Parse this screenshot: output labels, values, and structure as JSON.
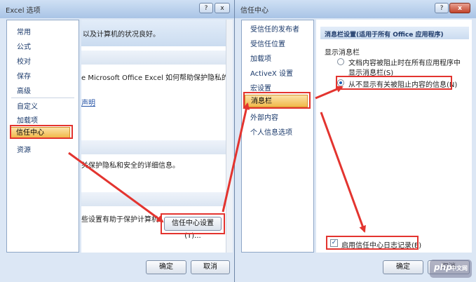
{
  "left_dialog": {
    "title": "Excel 选项",
    "help_glyph": "?",
    "close_glyph": "x",
    "nav_items": [
      "常用",
      "公式",
      "校对",
      "保存",
      "高级",
      "自定义",
      "加载项",
      "信任中心",
      "资源"
    ],
    "selected_nav": "信任中心",
    "content": {
      "line1": "以及计算机的状况良好。",
      "line2": "e Microsoft Office Excel 如何帮助保护隐私的详",
      "link1": "声明",
      "line3": "关保护隐私和安全的详细信息。",
      "line4": "些设置有助于保护计算机",
      "trust_center_settings_button": "信任中心设置(T)..."
    },
    "ok_button": "确定",
    "cancel_button": "取消"
  },
  "right_dialog": {
    "title": "信任中心",
    "help_glyph": "?",
    "close_glyph": "x",
    "nav_items": [
      "受信任的发布者",
      "受信任位置",
      "加载项",
      "ActiveX 设置",
      "宏设置",
      "消息栏",
      "外部内容",
      "个人信息选项"
    ],
    "selected_nav": "消息栏",
    "section_title": "消息栏设置(适用于所有 Office 应用程序)",
    "group_label": "显示消息栏",
    "radio_option_1_line1": "文档内容被阻止时在所有应用程序中",
    "radio_option_1_line2": "显示消息栏(S)",
    "radio_option_2": "从不显示有关被阻止内容的信息(N)",
    "selected_option": 2,
    "checkbox_label": "启用信任中心日志记录(E)",
    "checkbox_checked": true,
    "checkbox_glyph": "✓",
    "ok_button": "确定",
    "cancel_button": "取消"
  },
  "watermark": {
    "text": "php",
    "suffix": "中文网"
  },
  "colors": {
    "highlight": "#e3342f",
    "selected_nav": "#f1b94a",
    "title_gradient": "#a9c4e6"
  }
}
